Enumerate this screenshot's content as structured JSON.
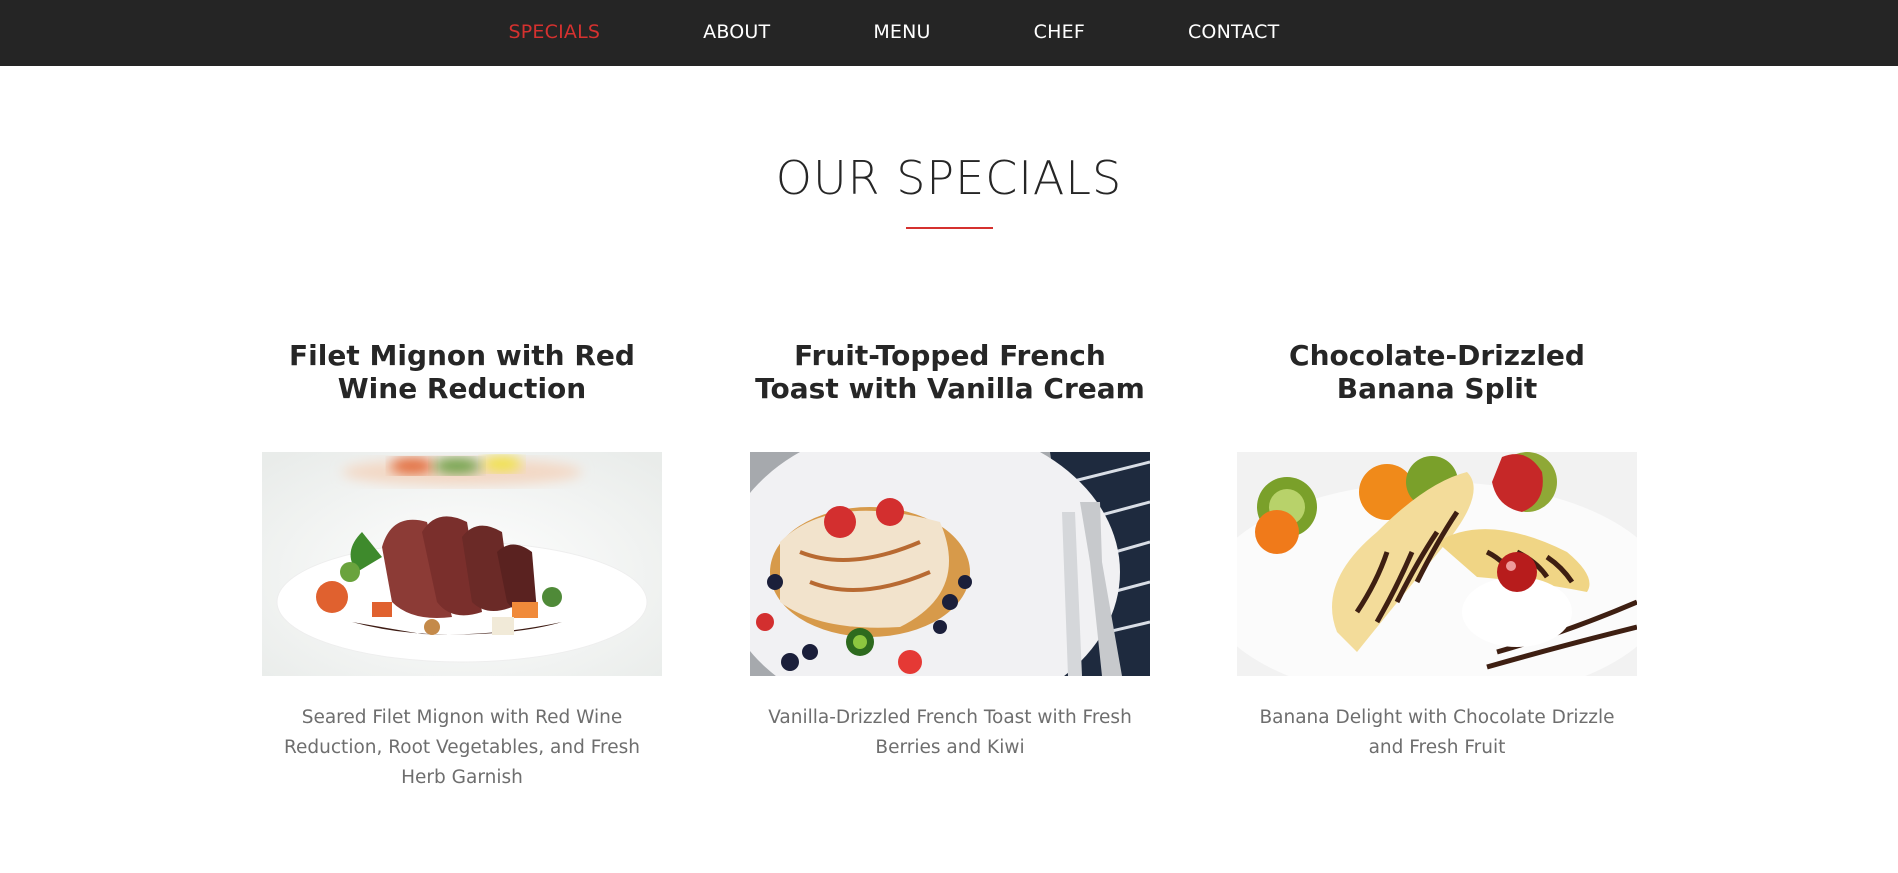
{
  "nav": {
    "items": [
      {
        "label": "SPECIALS",
        "active": true
      },
      {
        "label": "ABOUT",
        "active": false
      },
      {
        "label": "MENU",
        "active": false
      },
      {
        "label": "CHEF",
        "active": false
      },
      {
        "label": "CONTACT",
        "active": false
      }
    ]
  },
  "specials": {
    "title": "OUR SPECIALS",
    "accent_color": "#d5312f",
    "items": [
      {
        "title": "Filet Mignon with Red Wine Reduction",
        "image": "filet-mignon-photo",
        "description": "Seared Filet Mignon with Red Wine Reduction, Root Vegetables, and Fresh Herb Garnish"
      },
      {
        "title": "Fruit-Topped French Toast with Vanilla Cream",
        "image": "french-toast-photo",
        "description": "Vanilla-Drizzled French Toast with Fresh Berries and Kiwi"
      },
      {
        "title": "Chocolate-Drizzled Banana Split",
        "image": "banana-split-photo",
        "description": "Banana Delight with Chocolate Drizzle and Fresh Fruit"
      }
    ]
  }
}
